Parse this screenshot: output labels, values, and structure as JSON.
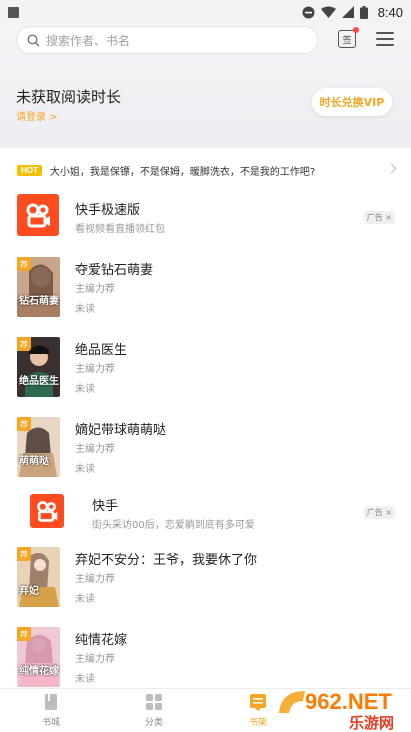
{
  "status_bar": {
    "time": "8:40"
  },
  "header": {
    "search_placeholder": "搜索作者、书名",
    "sign_label": "签"
  },
  "reading": {
    "title": "未获取阅读时长",
    "login": "请登录 >",
    "vip_button": "时长兑换VIP"
  },
  "notice": {
    "badge": "HOT",
    "text": "大小姐，我是保镖，不是保姆，暖脚洗衣，不是我的工作吧?"
  },
  "items": [
    {
      "type": "ad",
      "title": "快手极速版",
      "sub": "看视频看直播领红包",
      "ad_label": "广告 ×"
    },
    {
      "type": "book",
      "title": "夺爱钻石萌妻",
      "sub": "主编力荐",
      "status": "未读",
      "tag": "荐",
      "cover_text": "钻石萌妻",
      "cover_color": "#c9a58a"
    },
    {
      "type": "book",
      "title": "绝品医生",
      "sub": "主编力荐",
      "status": "未读",
      "tag": "荐",
      "cover_text": "绝品医生",
      "cover_color": "#3a3030"
    },
    {
      "type": "book",
      "title": "嫡妃带球萌萌哒",
      "sub": "主编力荐",
      "status": "未读",
      "tag": "荐",
      "cover_text": "萌萌哒",
      "cover_color": "#e9d7c4"
    },
    {
      "type": "ad",
      "title": "快手",
      "sub": "街头采访00后，恋爱躺到底有多可爱",
      "ad_label": "广告 ×"
    },
    {
      "type": "book",
      "title": "弃妃不安分：王爷，我要休了你",
      "sub": "主编力荐",
      "status": "未读",
      "tag": "荐",
      "cover_text": "弃妃",
      "cover_color": "#e8d3b5"
    },
    {
      "type": "book",
      "title": "纯情花嫁",
      "sub": "主编力荐",
      "status": "未读",
      "tag": "荐",
      "cover_text": "纯情花嫁",
      "cover_color": "#efc9d3"
    }
  ],
  "tabs": [
    {
      "label": "书城"
    },
    {
      "label": "分类"
    },
    {
      "label": "书架"
    }
  ],
  "watermark": {
    "brand": "962.NET",
    "sub": "乐游网"
  },
  "colors": {
    "accent": "#f5a623",
    "kuaishou": "#ff4c1f"
  }
}
